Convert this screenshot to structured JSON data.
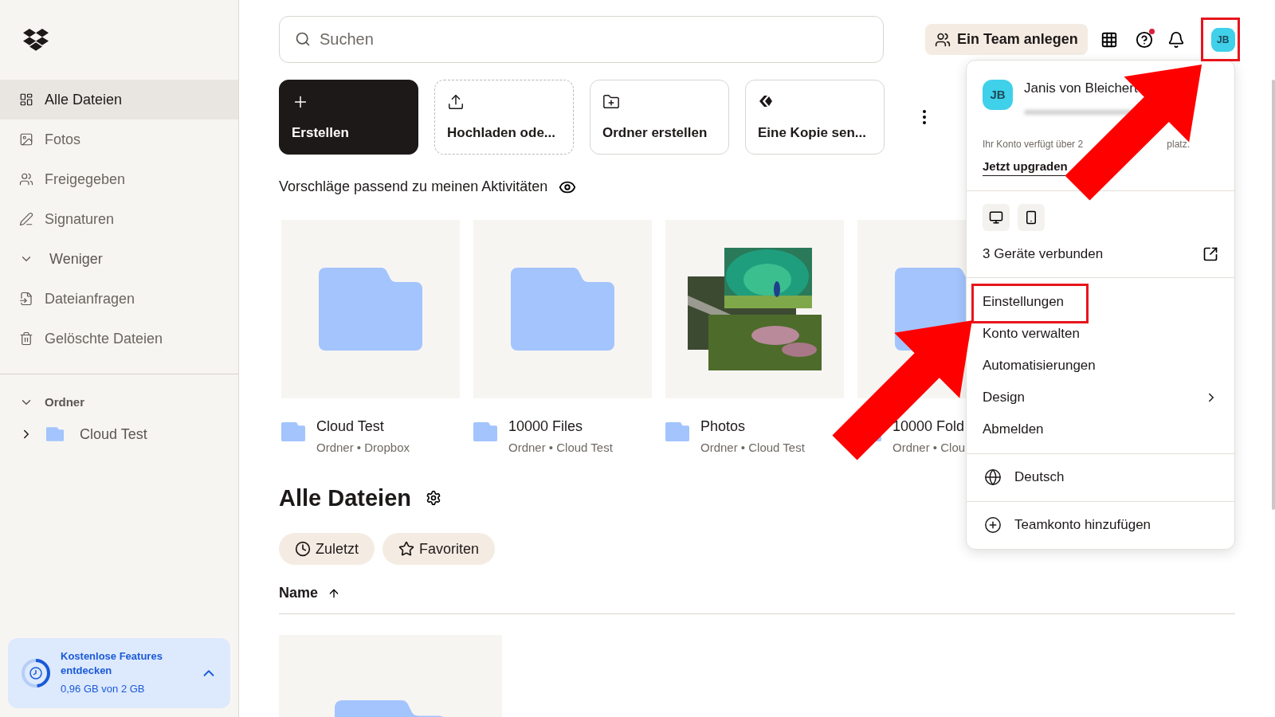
{
  "sidebar": {
    "items": [
      {
        "label": "Alle Dateien",
        "kind": "link",
        "selected": true
      },
      {
        "label": "Fotos",
        "kind": "link",
        "selected": false
      },
      {
        "label": "Freigegeben",
        "kind": "link",
        "selected": false
      },
      {
        "label": "Signaturen",
        "kind": "link",
        "selected": false
      },
      {
        "label": "Weniger",
        "kind": "toggle",
        "selected": false,
        "expanded": true
      },
      {
        "label": "Dateianfragen",
        "kind": "link",
        "selected": false
      },
      {
        "label": "Gelöschte Dateien",
        "kind": "link",
        "selected": false
      }
    ],
    "section": {
      "label": "Ordner",
      "expanded": true
    },
    "tree": [
      {
        "label": "Cloud Test",
        "expanded": false
      }
    ],
    "promo": {
      "title": "Kostenlose Features entdecken",
      "usage": "0,96 GB von 2 GB",
      "level": 0.48,
      "expanded": false
    }
  },
  "search": {
    "placeholder": "Suchen"
  },
  "header": {
    "team_button": "Ein Team anlegen",
    "help_notification": true,
    "initials": "JB"
  },
  "actions": [
    {
      "label": "Erstellen",
      "kind": "primary"
    },
    {
      "label": "Hochladen ode...",
      "kind": "dashed"
    },
    {
      "label": "Ordner erstellen",
      "kind": "outline"
    },
    {
      "label": "Eine Kopie sen...",
      "kind": "outline"
    }
  ],
  "suggestions": {
    "title": "Vorschläge passend zu meinen Aktivitäten",
    "items": [
      {
        "name": "Cloud Test",
        "meta": "Ordner • Dropbox",
        "kind": "folder"
      },
      {
        "name": "10000 Files",
        "meta": "Ordner • Cloud Test",
        "kind": "folder"
      },
      {
        "name": "Photos",
        "meta": "Ordner • Cloud Test",
        "kind": "photos"
      },
      {
        "name": "10000 Fold",
        "meta": "Ordner • Clou",
        "kind": "folder"
      }
    ]
  },
  "files": {
    "title": "Alle Dateien",
    "filters": [
      {
        "label": "Zuletzt",
        "kind": "recent"
      },
      {
        "label": "Favoriten",
        "kind": "starred"
      }
    ],
    "sort": {
      "column": "Name",
      "ascending": true
    }
  },
  "account_menu": {
    "initials": "JB",
    "name": "Janis von Bleichert",
    "storage_note": [
      "Ihr Konto verfügt über 2",
      "platz."
    ],
    "upgrade_link": "Jetzt upgraden",
    "devices_label": "3 Geräte verbunden",
    "items": [
      {
        "label": "Einstellungen",
        "kind": "item"
      },
      {
        "label": "Konto verwalten",
        "kind": "item"
      },
      {
        "label": "Automatisierungen",
        "kind": "item"
      },
      {
        "label": "Design",
        "kind": "submenu"
      },
      {
        "label": "Abmelden",
        "kind": "item"
      }
    ],
    "language": "Deutsch",
    "add_team": "Teamkonto hinzufügen"
  }
}
